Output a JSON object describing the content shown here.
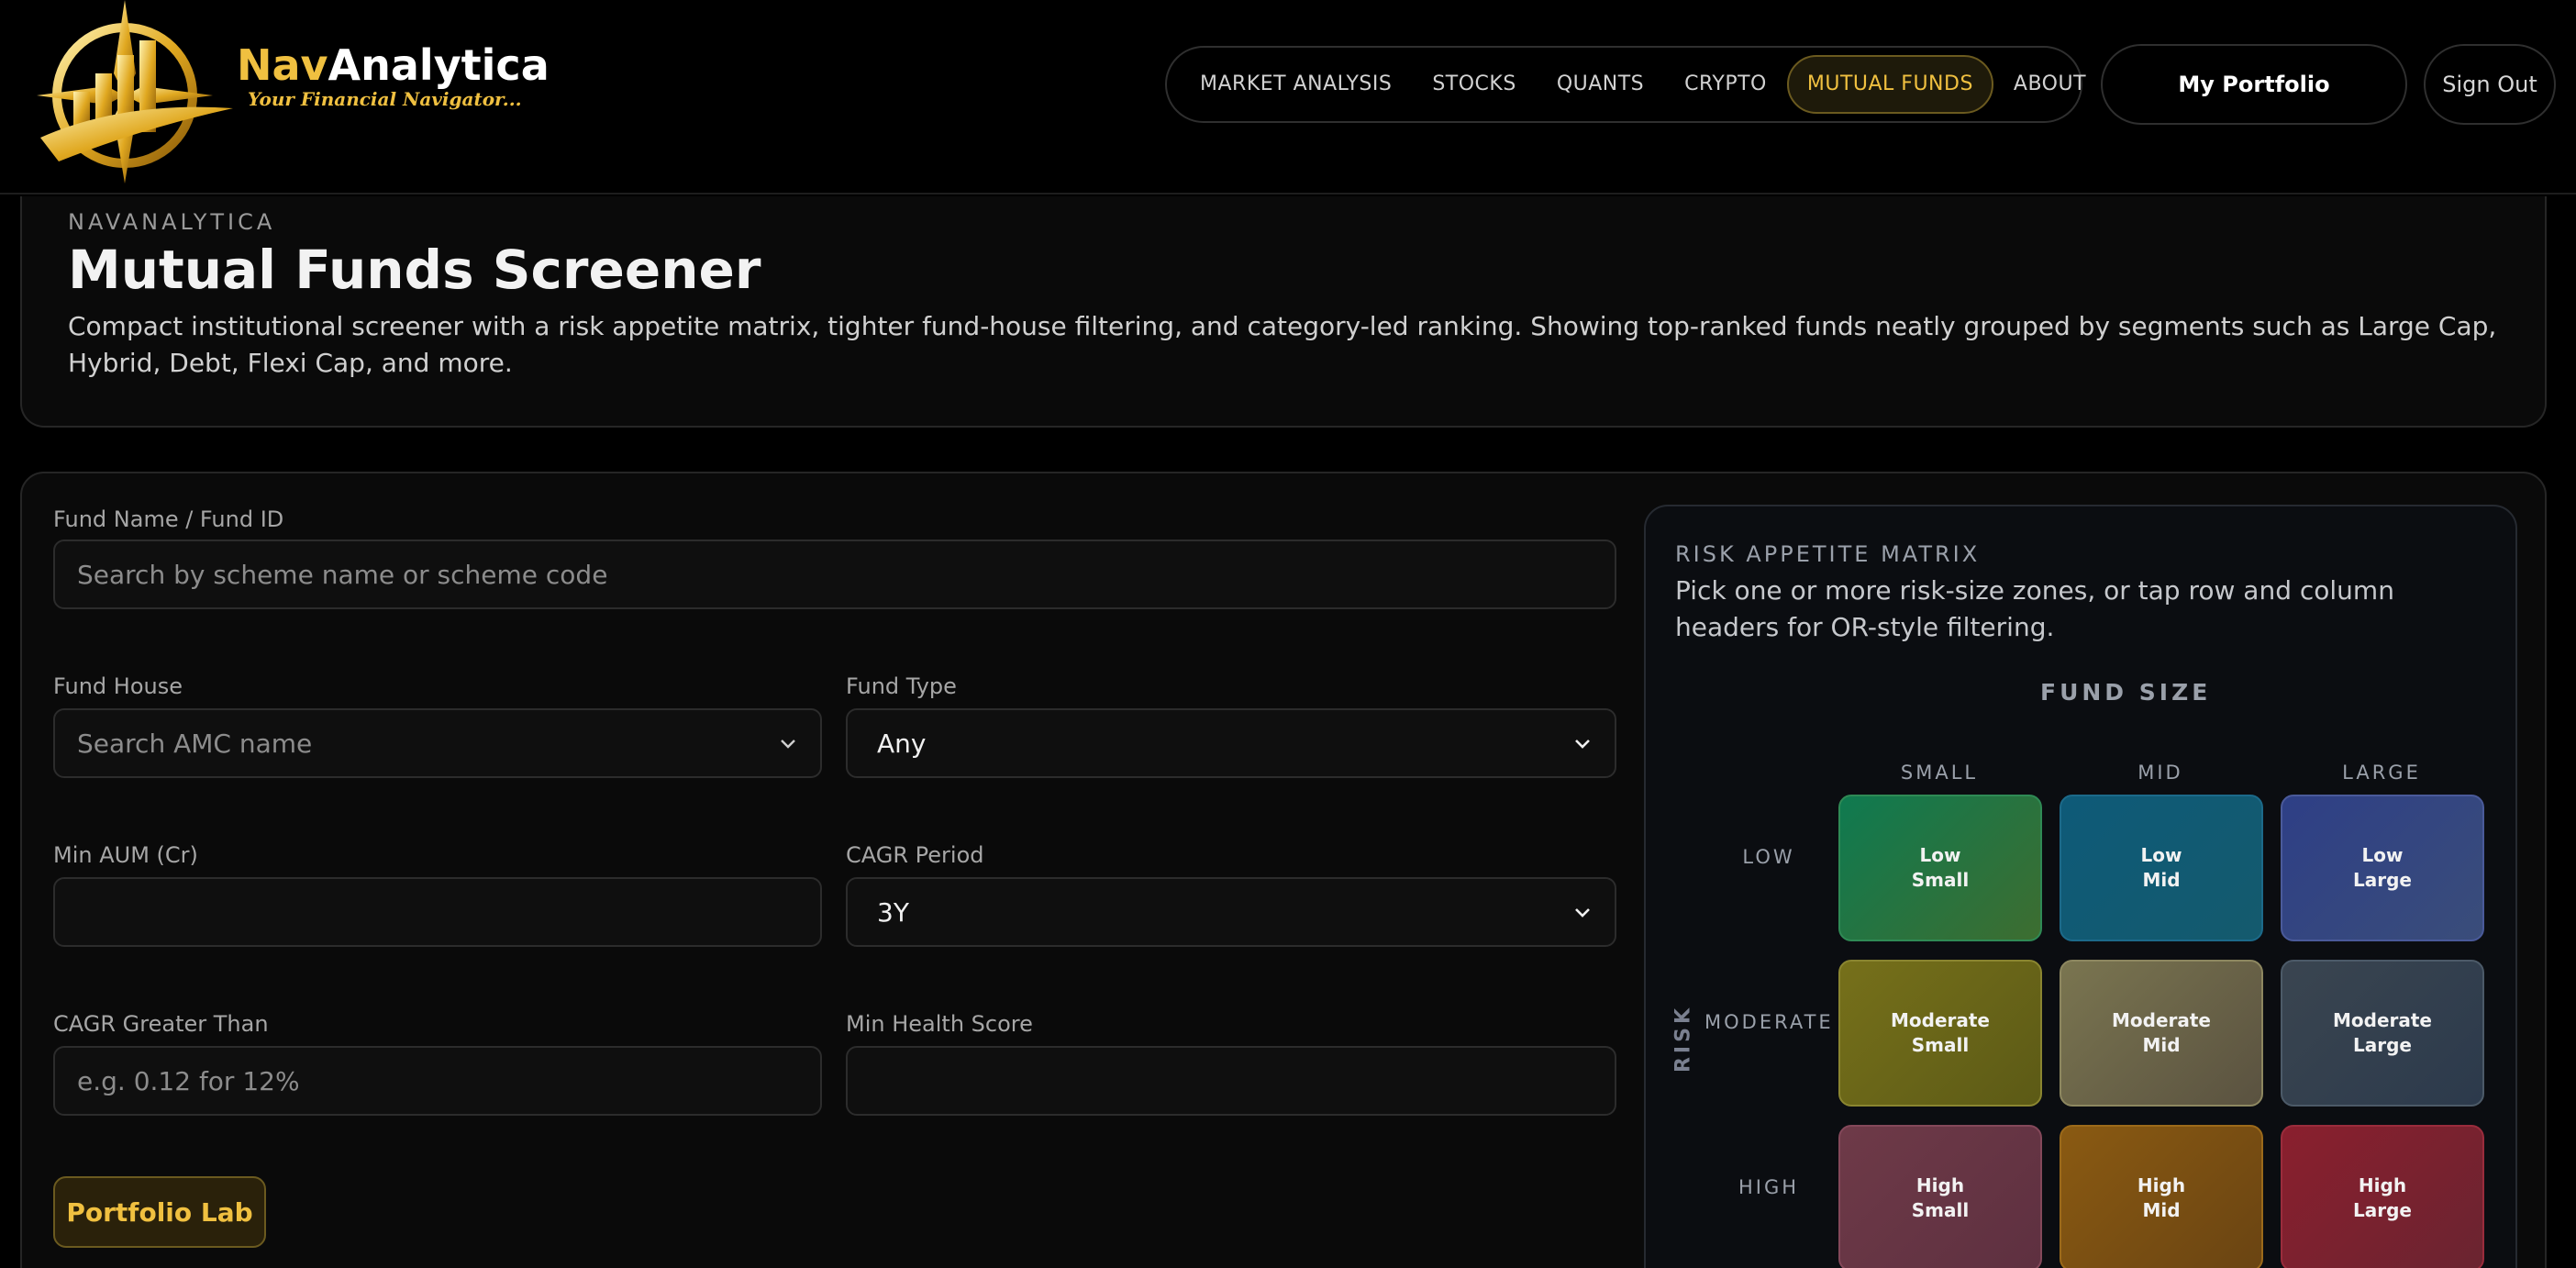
{
  "brand": {
    "name_part1": "Nav",
    "name_part2": "Analytica",
    "tagline": "Your Financial Navigator..."
  },
  "nav": {
    "items": [
      {
        "label": "MARKET ANALYSIS",
        "active": false
      },
      {
        "label": "STOCKS",
        "active": false
      },
      {
        "label": "QUANTS",
        "active": false
      },
      {
        "label": "CRYPTO",
        "active": false
      },
      {
        "label": "MUTUAL FUNDS",
        "active": true
      },
      {
        "label": "ABOUT",
        "active": false
      }
    ],
    "portfolio_label": "My Portfolio",
    "signout_label": "Sign Out"
  },
  "hero": {
    "eyebrow": "NAVANALYTICA",
    "title": "Mutual Funds Screener",
    "description": "Compact institutional screener with a risk appetite matrix, tighter fund-house filtering, and category-led ranking. Showing top-ranked funds neatly grouped by segments such as Large Cap, Hybrid, Debt, Flexi Cap, and more."
  },
  "filters": {
    "fund_name": {
      "label": "Fund Name / Fund ID",
      "placeholder": "Search by scheme name or scheme code"
    },
    "fund_house": {
      "label": "Fund House",
      "placeholder": "Search AMC name"
    },
    "fund_type": {
      "label": "Fund Type",
      "value": "Any"
    },
    "min_aum": {
      "label": "Min AUM (Cr)",
      "value": ""
    },
    "cagr_period": {
      "label": "CAGR Period",
      "value": "3Y"
    },
    "cagr_greater": {
      "label": "CAGR Greater Than",
      "placeholder": "e.g. 0.12 for 12%"
    },
    "min_health": {
      "label": "Min Health Score",
      "value": ""
    },
    "portfolio_lab_label": "Portfolio Lab"
  },
  "matrix": {
    "eyebrow": "RISK APPETITE MATRIX",
    "description": "Pick one or more risk-size zones, or tap row and column headers for OR-style filtering.",
    "size_title": "FUND SIZE",
    "risk_title": "RISK",
    "columns": [
      "SMALL",
      "MID",
      "LARGE"
    ],
    "rows": [
      "LOW",
      "MODERATE",
      "HIGH"
    ],
    "cells": [
      [
        {
          "risk": "Low",
          "size": "Small"
        },
        {
          "risk": "Low",
          "size": "Mid"
        },
        {
          "risk": "Low",
          "size": "Large"
        }
      ],
      [
        {
          "risk": "Moderate",
          "size": "Small"
        },
        {
          "risk": "Moderate",
          "size": "Mid"
        },
        {
          "risk": "Moderate",
          "size": "Large"
        }
      ],
      [
        {
          "risk": "High",
          "size": "Small"
        },
        {
          "risk": "High",
          "size": "Mid"
        },
        {
          "risk": "High",
          "size": "Large"
        }
      ]
    ]
  },
  "colors": {
    "accent": "#f0c040",
    "background": "#000000",
    "card": "#0a0a0a"
  }
}
